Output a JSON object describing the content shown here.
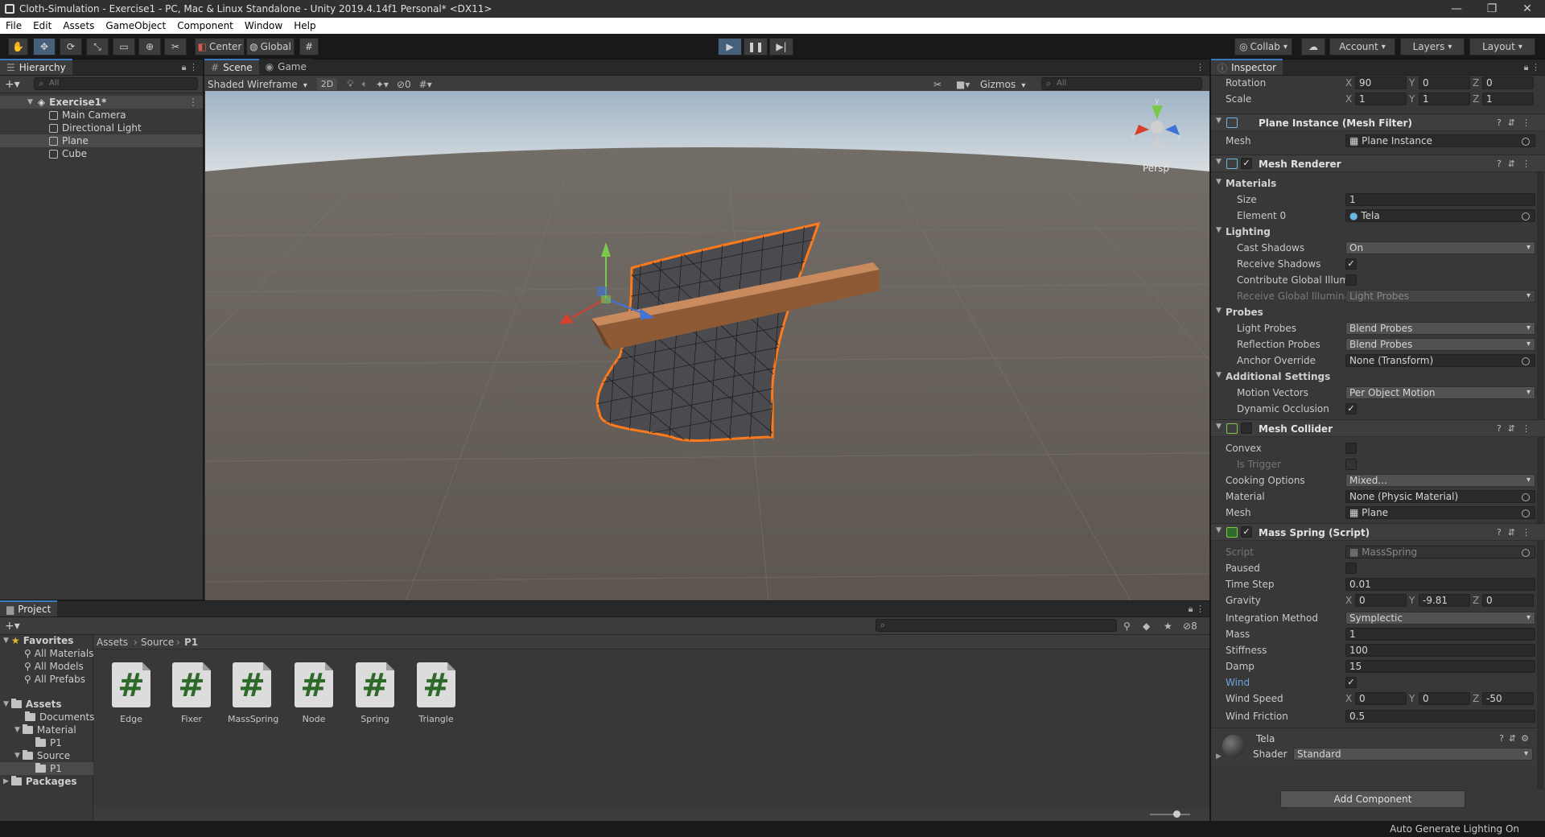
{
  "window": {
    "title": "Cloth-Simulation - Exercise1 - PC, Mac & Linux Standalone - Unity 2019.4.14f1 Personal* <DX11>"
  },
  "menu": [
    "File",
    "Edit",
    "Assets",
    "GameObject",
    "Component",
    "Window",
    "Help"
  ],
  "toolbar": {
    "pivot": "Center",
    "space": "Global",
    "collab": "Collab",
    "account": "Account",
    "layers": "Layers",
    "layout": "Layout"
  },
  "hierarchy": {
    "tab": "Hierarchy",
    "search_placeholder": "All",
    "scene": "Exercise1*",
    "items": [
      "Main Camera",
      "Directional Light",
      "Plane",
      "Cube"
    ]
  },
  "scene": {
    "tab_scene": "Scene",
    "tab_game": "Game",
    "shading": "Shaded Wireframe",
    "mode2d": "2D",
    "hidden_count": "0",
    "gizmos": "Gizmos",
    "search_placeholder": "All",
    "persp": "Persp",
    "gizmo_x": "x",
    "gizmo_z": "z",
    "gizmo_y": "y"
  },
  "inspector": {
    "tab": "Inspector",
    "transform": {
      "rotation_label": "Rotation",
      "rot": [
        "90",
        "0",
        "0"
      ],
      "scale_label": "Scale",
      "scale": [
        "1",
        "1",
        "1"
      ]
    },
    "meshfilter": {
      "title": "Plane Instance (Mesh Filter)",
      "mesh_label": "Mesh",
      "mesh": "Plane Instance"
    },
    "meshrenderer": {
      "title": "Mesh Renderer",
      "materials": "Materials",
      "size_label": "Size",
      "size": "1",
      "element_label": "Element 0",
      "element": "Tela",
      "lighting": "Lighting",
      "cast_label": "Cast Shadows",
      "cast": "On",
      "receive_label": "Receive Shadows",
      "contribute_label": "Contribute Global Illumi",
      "receive_gi_label": "Receive Global Illumina",
      "receive_gi": "Light Probes",
      "probes": "Probes",
      "lightprobes_label": "Light Probes",
      "lightprobes": "Blend Probes",
      "reflection_label": "Reflection Probes",
      "reflection": "Blend Probes",
      "anchor_label": "Anchor Override",
      "anchor": "None (Transform)",
      "additional": "Additional Settings",
      "motion_label": "Motion Vectors",
      "motion": "Per Object Motion",
      "dynocc_label": "Dynamic Occlusion"
    },
    "meshcollider": {
      "title": "Mesh Collider",
      "convex_label": "Convex",
      "trigger_label": "Is Trigger",
      "cooking_label": "Cooking Options",
      "cooking": "Mixed...",
      "material_label": "Material",
      "material": "None (Physic Material)",
      "mesh_label": "Mesh",
      "mesh": "Plane"
    },
    "massspring": {
      "title": "Mass Spring (Script)",
      "script_label": "Script",
      "script": "MassSpring",
      "paused_label": "Paused",
      "timestep_label": "Time Step",
      "timestep": "0.01",
      "gravity_label": "Gravity",
      "gravity": [
        "0",
        "-9.81",
        "0"
      ],
      "integration_label": "Integration Method",
      "integration": "Symplectic",
      "mass_label": "Mass",
      "mass": "1",
      "stiffness_label": "Stiffness",
      "stiffness": "100",
      "damp_label": "Damp",
      "damp": "15",
      "wind_label": "Wind",
      "windspeed_label": "Wind Speed",
      "windspeed": [
        "0",
        "0",
        "-50"
      ],
      "windfriction_label": "Wind Friction",
      "windfriction": "0.5"
    },
    "material": {
      "name": "Tela",
      "shader_label": "Shader",
      "shader": "Standard"
    },
    "add_component": "Add Component",
    "axes": {
      "x": "X",
      "y": "Y",
      "z": "Z"
    }
  },
  "project": {
    "tab": "Project",
    "hidden_count": "8",
    "favorites": "Favorites",
    "fav_items": [
      "All Materials",
      "All Models",
      "All Prefabs"
    ],
    "assets": "Assets",
    "tree": [
      "Documents",
      "Material",
      "P1",
      "Source",
      "P1"
    ],
    "packages": "Packages",
    "breadcrumb": [
      "Assets",
      "Source",
      "P1"
    ],
    "files": [
      "Edge",
      "Fixer",
      "MassSpring",
      "Node",
      "Spring",
      "Triangle"
    ]
  },
  "status": "Auto Generate Lighting On"
}
